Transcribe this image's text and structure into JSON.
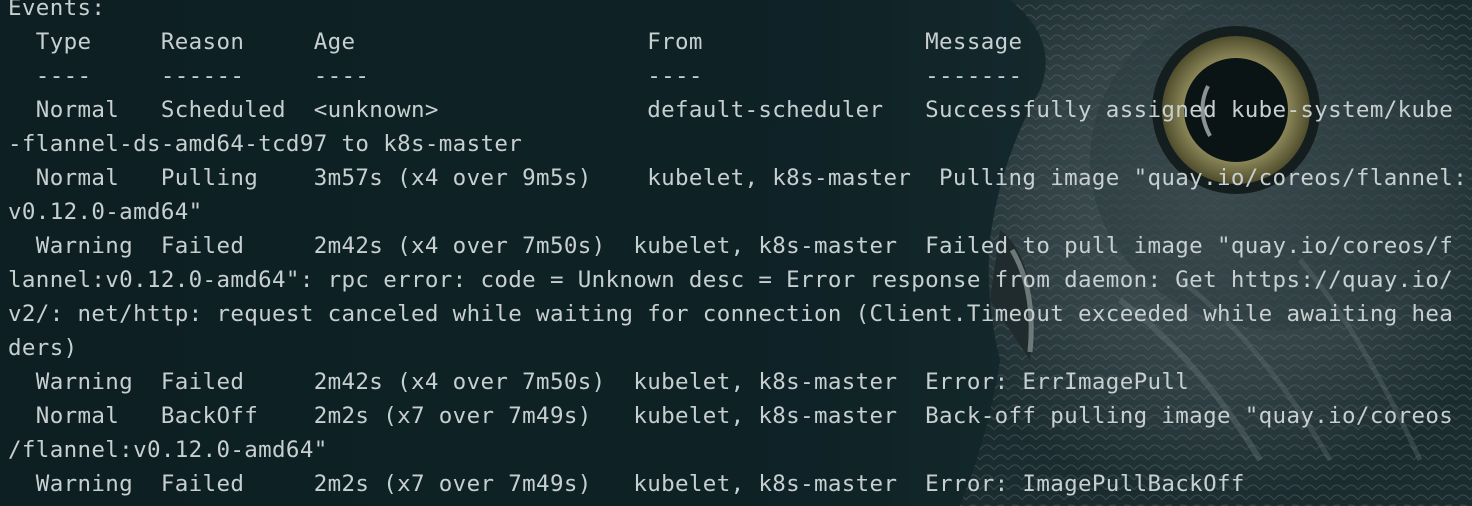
{
  "terminal": {
    "lines": [
      "Events:",
      "  Type     Reason     Age                     From                Message",
      "  ----     ------     ----                    ----                -------",
      "  Normal   Scheduled  <unknown>               default-scheduler   Successfully assigned kube-system/kube",
      "-flannel-ds-amd64-tcd97 to k8s-master",
      "  Normal   Pulling    3m57s (x4 over 9m5s)    kubelet, k8s-master  Pulling image \"quay.io/coreos/flannel:",
      "v0.12.0-amd64\"",
      "  Warning  Failed     2m42s (x4 over 7m50s)  kubelet, k8s-master  Failed to pull image \"quay.io/coreos/f",
      "lannel:v0.12.0-amd64\": rpc error: code = Unknown desc = Error response from daemon: Get https://quay.io/",
      "v2/: net/http: request canceled while waiting for connection (Client.Timeout exceeded while awaiting hea",
      "ders)",
      "  Warning  Failed     2m42s (x4 over 7m50s)  kubelet, k8s-master  Error: ErrImagePull",
      "  Normal   BackOff    2m2s (x7 over 7m49s)   kubelet, k8s-master  Back-off pulling image \"quay.io/coreos",
      "/flannel:v0.12.0-amd64\"",
      "  Warning  Failed     2m2s (x7 over 7m49s)   kubelet, k8s-master  Error: ImagePullBackOff"
    ]
  },
  "colors": {
    "background": "#0f2226",
    "text": "#c7cfd1"
  }
}
